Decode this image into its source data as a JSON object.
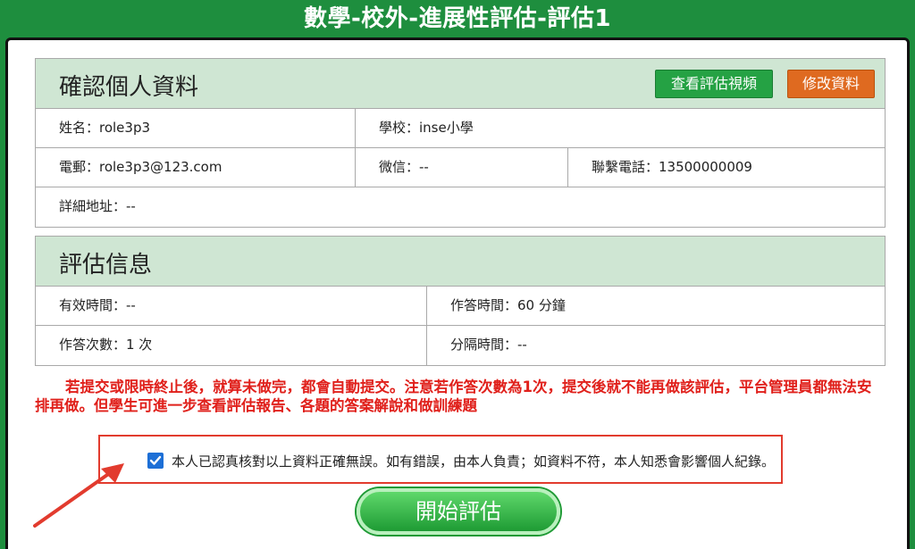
{
  "title": "數學-校外-進展性評估-評估1",
  "profile": {
    "heading": "確認個人資料",
    "view_video_button": "查看評估視頻",
    "edit_button": "修改資料",
    "name": "姓名：role3p3",
    "school": "學校：inse小學",
    "email": "電郵：role3p3@123.com",
    "wechat": "微信：--",
    "phone": "聯繫電話：13500000009",
    "address": "詳細地址：--"
  },
  "assessment": {
    "heading": "評估信息",
    "valid_time": "有效時間：--",
    "answer_time": "作答時間：60 分鐘",
    "attempts": "作答次數：1 次",
    "interval": "分隔時間：--"
  },
  "notice": "若提交或限時終止後，就算未做完，都會自動提交。注意若作答次數為1次，提交後就不能再做該評估，平台管理員都無法安排再做。但學生可進一步查看評估報告、各題的答案解說和做訓練題",
  "confirm": {
    "checked": true,
    "text": "本人已認真核對以上資料正確無誤。如有錯誤，由本人負責；如資料不符，本人知悉會影響個人紀錄。"
  },
  "start_button": "開始評估",
  "colors": {
    "brand_green": "#1e8e3e",
    "section_header": "#cfe6d3",
    "notice_red": "#e0201b",
    "orange": "#df6a20",
    "checkbox_blue": "#1d6fd6"
  }
}
